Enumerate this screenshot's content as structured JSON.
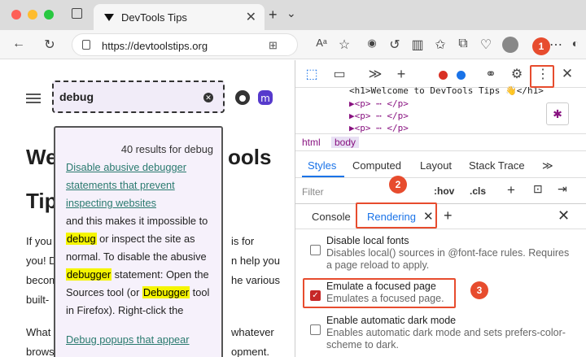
{
  "browser": {
    "tab_title": "DevTools Tips",
    "new_tab": "+",
    "tab_menu": "⌄",
    "url": "https://devtoolstips.org"
  },
  "page": {
    "search_value": "debug",
    "heading_line1": "We",
    "heading_line1_tail": "ools",
    "heading_line2": "Tip",
    "para1_left": "If you",
    "para1_right": "is for",
    "para2_left": "you! D",
    "para2_right": "n help you",
    "para3_left": "becom",
    "para3_right": "he various",
    "para4_left": "built-",
    "para5_left": "What",
    "para5_right": "whatever",
    "para6_left": "brows",
    "para6_right": "opment."
  },
  "search_results": {
    "count_text": "40 results for debug",
    "result1_title": "Disable abusive debugger statements that prevent inspecting websites",
    "result1_desc": {
      "t1": "and this makes it impossible to ",
      "m1": "debug",
      "t2": " or inspect the site as normal. To disable the abusive ",
      "m2": "debugger",
      "t3": " statement: Open the Sources tool (or ",
      "m3": "Debugger",
      "t4": " tool in Firefox). Right-click the"
    },
    "result2_title": "Debug popups that appear"
  },
  "devtools": {
    "elements_lines": [
      "<h1>Welcome to DevTools Tips 👋</h1>",
      "▶<p> ⋯ </p>",
      "▶<p> ⋯ </p>",
      "▶<p> ⋯ </p>"
    ],
    "breadcrumbs": [
      "html",
      "body"
    ],
    "styles_tabs": [
      "Styles",
      "Computed",
      "Layout",
      "Stack Trace"
    ],
    "more_tabs": "≫",
    "filter_placeholder": "Filter",
    "hov": ":hov",
    "cls": ".cls",
    "drawer_tabs": [
      "Console",
      "Rendering"
    ],
    "options": [
      {
        "label": "Disable local fonts",
        "desc": "Disables local() sources in @font-face rules. Requires a page reload to apply.",
        "checked": false
      },
      {
        "label": "Emulate a focused page",
        "desc": "Emulates a focused page.",
        "checked": true
      },
      {
        "label": "Enable automatic dark mode",
        "desc": "Enables automatic dark mode and sets prefers-color-scheme to dark.",
        "checked": false
      }
    ]
  },
  "callouts": [
    "1",
    "2",
    "3"
  ],
  "colors": {
    "accent": "#e74c2e",
    "link": "#2a7a6f",
    "highlight": "#f5f500",
    "devtools_blue": "#1a73e8"
  }
}
